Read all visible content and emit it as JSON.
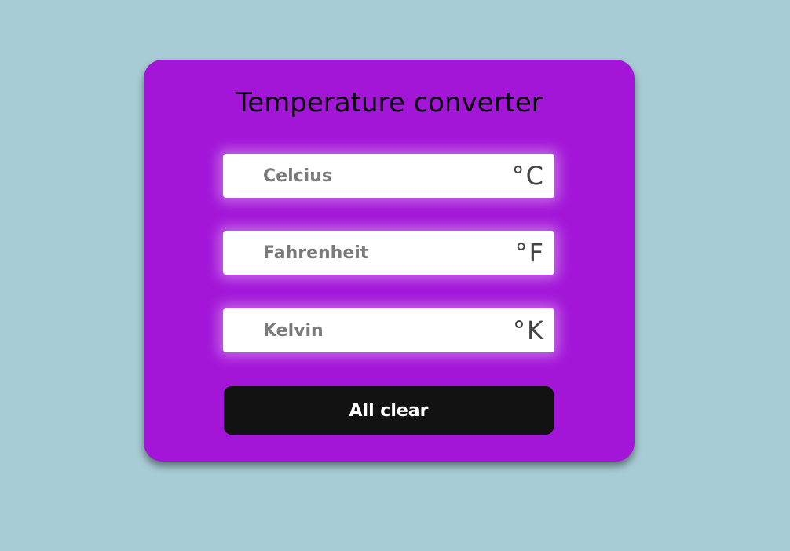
{
  "colors": {
    "page_background": "#a8ccd5",
    "card_background": "#a316d8",
    "button_background": "#121212",
    "button_text": "#ffffff"
  },
  "converter": {
    "title": "Temperature converter",
    "fields": [
      {
        "placeholder": "Celcius",
        "value": "",
        "unit": "°C"
      },
      {
        "placeholder": "Fahrenheit",
        "value": "",
        "unit": "°F"
      },
      {
        "placeholder": "Kelvin",
        "value": "",
        "unit": "°K"
      }
    ],
    "clear_label": "All clear"
  }
}
